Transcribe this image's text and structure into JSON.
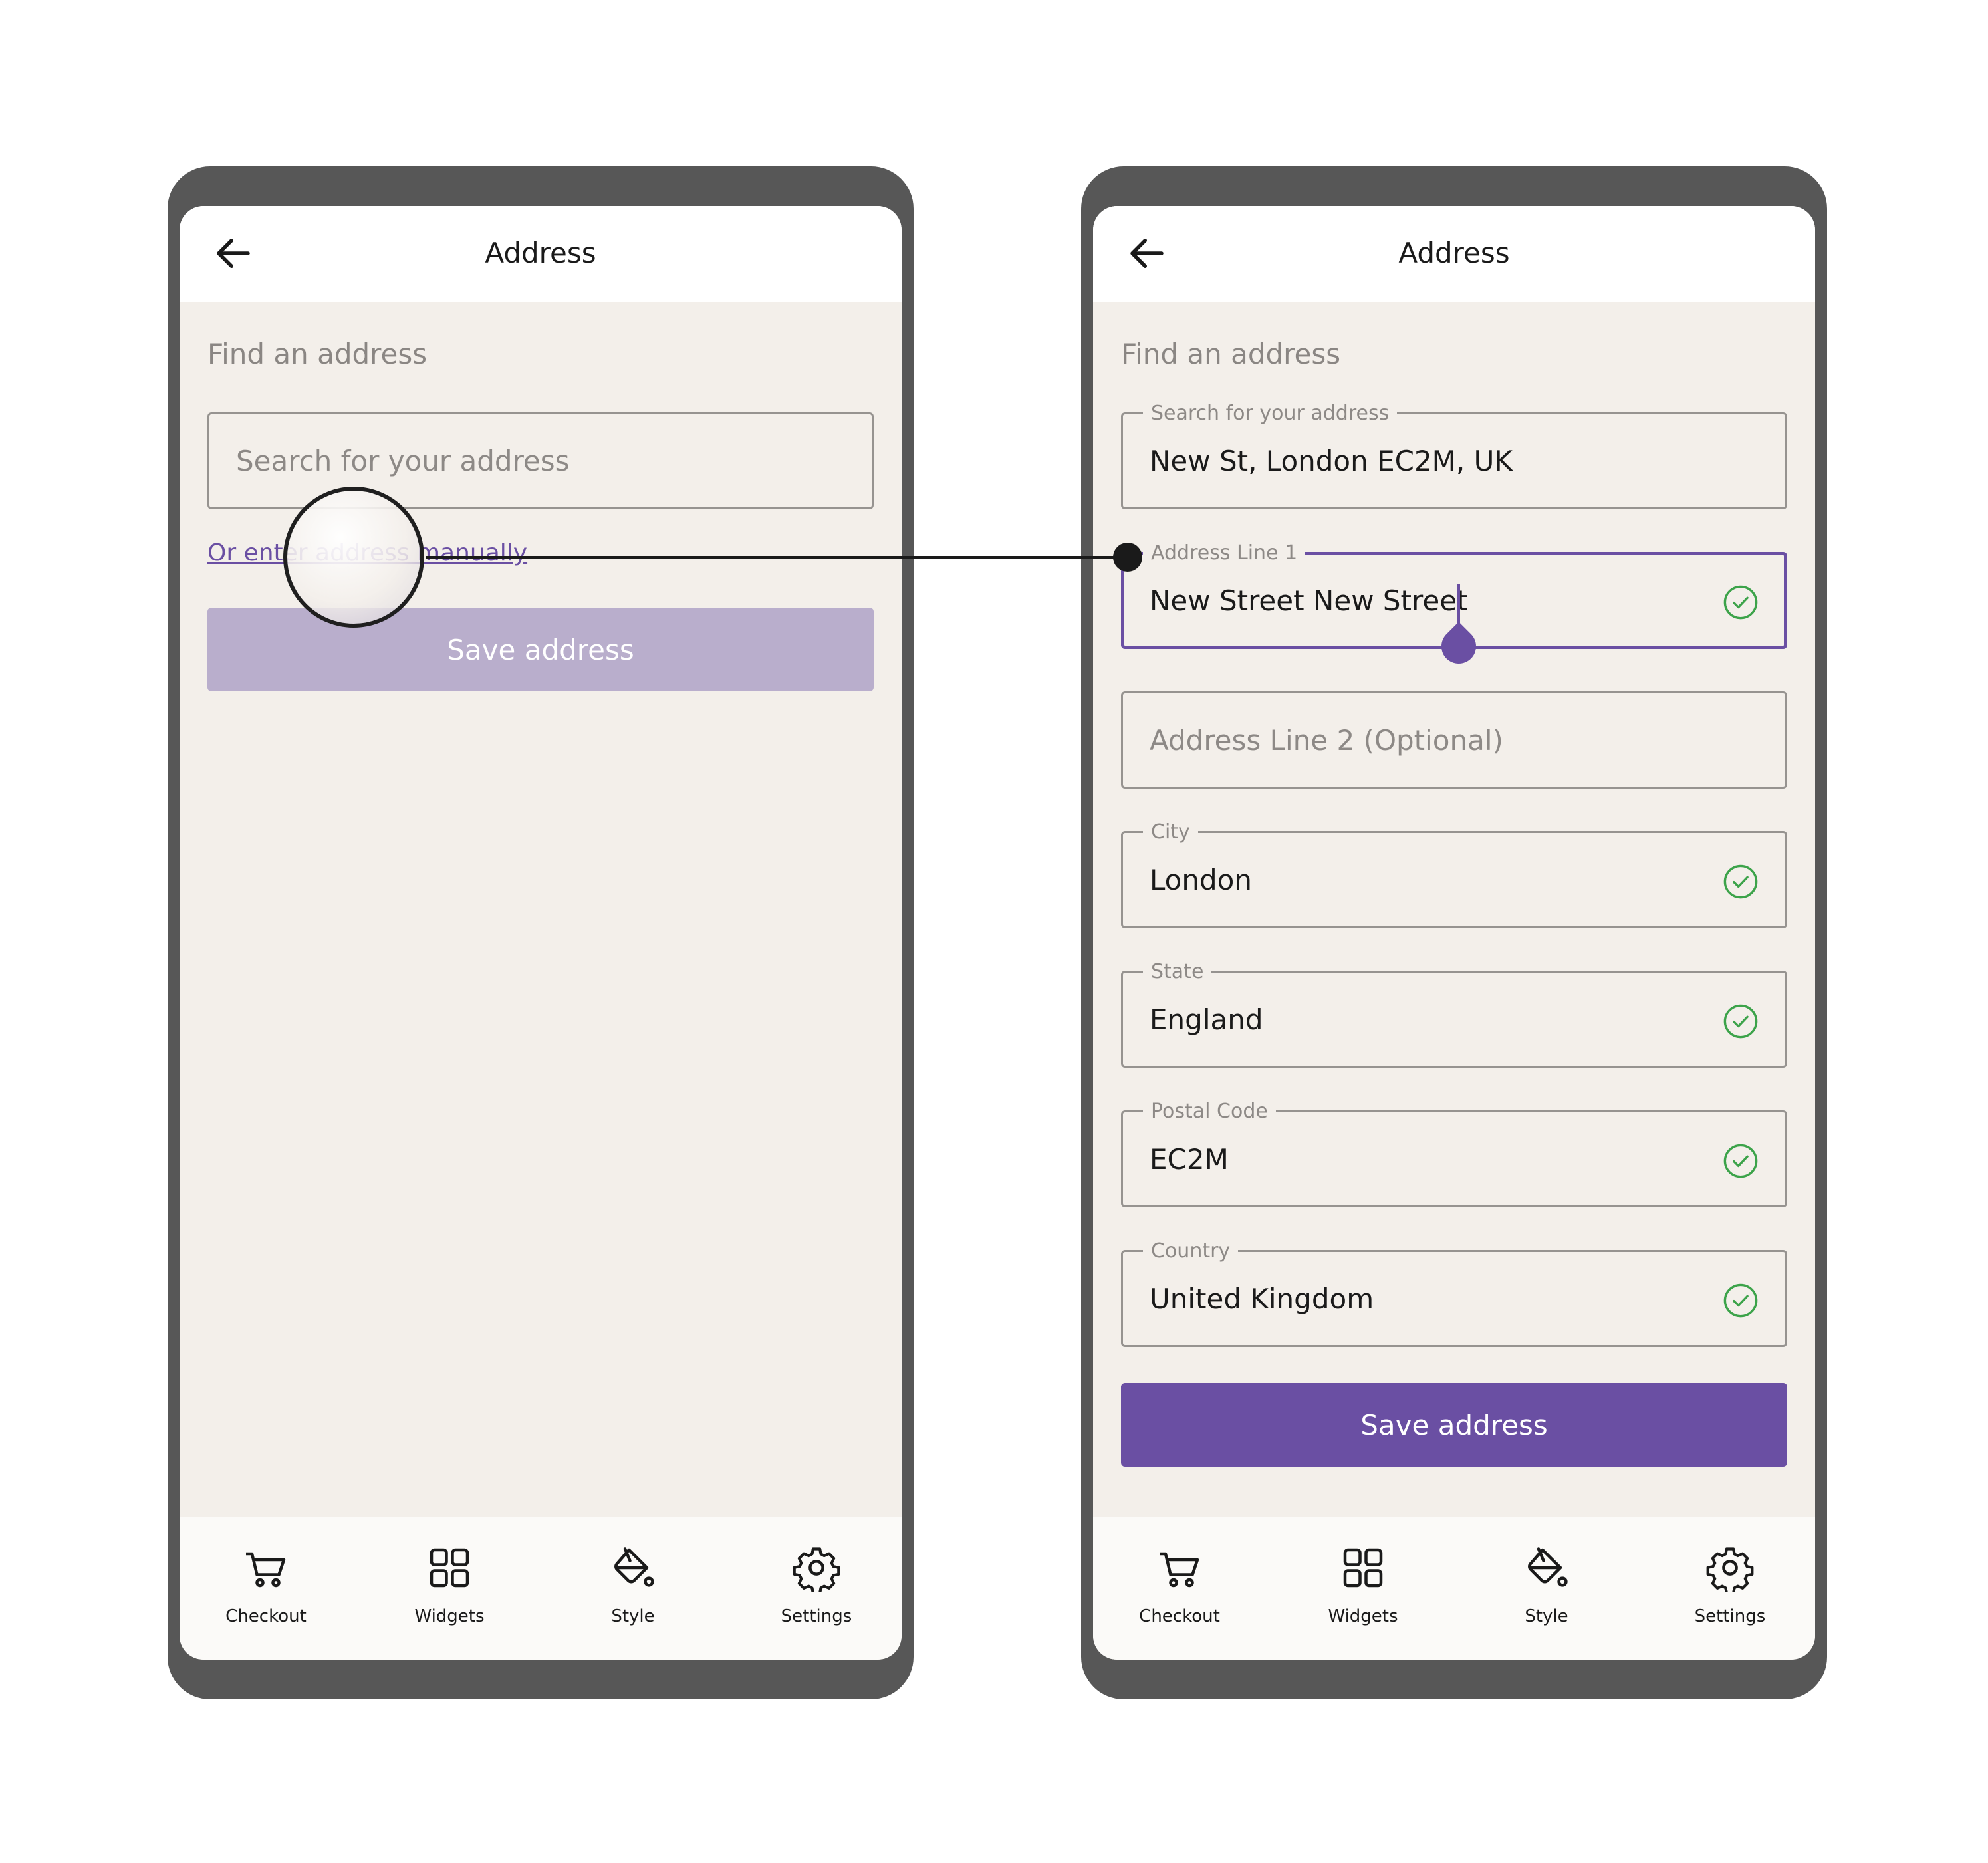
{
  "left_screen": {
    "title": "Address",
    "section_title": "Find an address",
    "search_placeholder": "Search for your address",
    "manual_link": "Or enter address manually",
    "save_button": "Save address"
  },
  "right_screen": {
    "title": "Address",
    "section_title": "Find an address",
    "fields": [
      {
        "label": "Search for your address",
        "value": "New St, London EC2M, UK"
      },
      {
        "label": "Address Line 1",
        "value": "New Street New Street"
      },
      {
        "placeholder": "Address Line 2 (Optional)"
      },
      {
        "label": "City",
        "value": "London"
      },
      {
        "label": "State",
        "value": "England"
      },
      {
        "label": "Postal Code",
        "value": "EC2M"
      },
      {
        "label": "Country",
        "value": "United Kingdom"
      }
    ],
    "save_button": "Save address"
  },
  "bottom_nav": [
    {
      "label": "Checkout",
      "icon": "cart-icon"
    },
    {
      "label": "Widgets",
      "icon": "grid-icon"
    },
    {
      "label": "Style",
      "icon": "paint-bucket-icon"
    },
    {
      "label": "Settings",
      "icon": "gear-icon"
    }
  ],
  "colors": {
    "accent": "#6a4fa3",
    "accent_disabled": "#b9aecc",
    "success": "#3ca34a",
    "screen_background": "#f3efea",
    "device_frame": "#575757"
  }
}
